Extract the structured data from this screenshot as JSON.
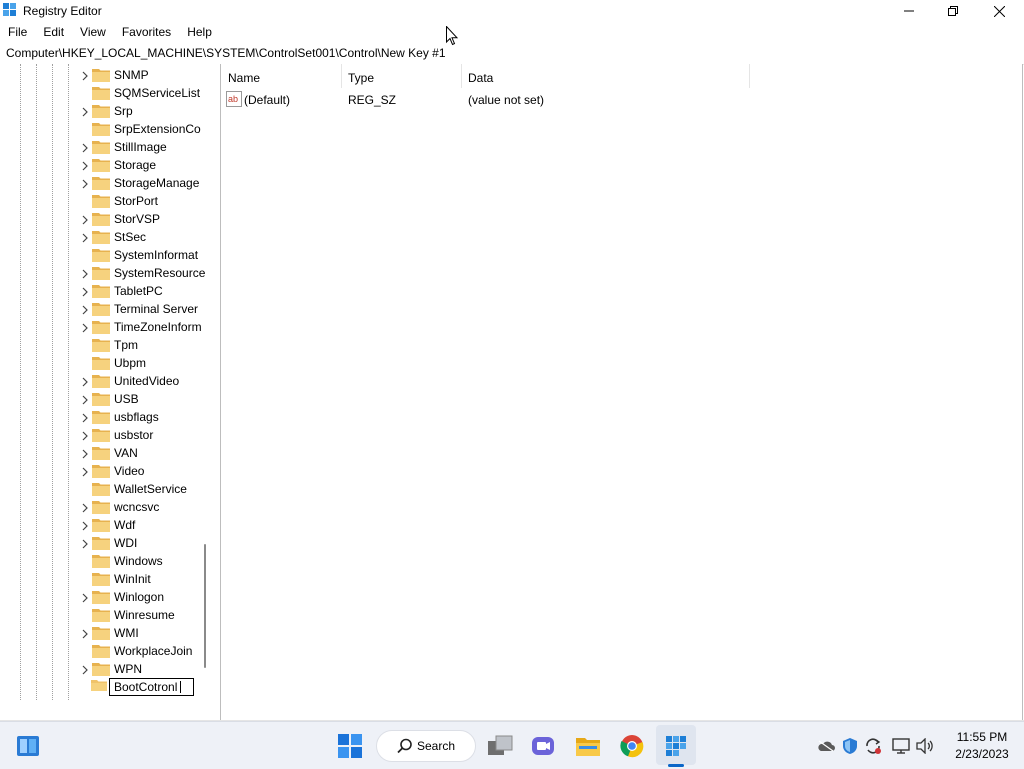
{
  "window": {
    "title": "Registry Editor",
    "icon": "registry-icon"
  },
  "menu": [
    "File",
    "Edit",
    "View",
    "Favorites",
    "Help"
  ],
  "address": {
    "path": "Computer\\HKEY_LOCAL_MACHINE\\SYSTEM\\ControlSet001\\Control\\New Key #1"
  },
  "tree": {
    "items": [
      {
        "label": "SNMP",
        "expandable": true
      },
      {
        "label": "SQMServiceList",
        "expandable": false
      },
      {
        "label": "Srp",
        "expandable": true
      },
      {
        "label": "SrpExtensionCo",
        "expandable": false
      },
      {
        "label": "StillImage",
        "expandable": true
      },
      {
        "label": "Storage",
        "expandable": true
      },
      {
        "label": "StorageManage",
        "expandable": true
      },
      {
        "label": "StorPort",
        "expandable": false
      },
      {
        "label": "StorVSP",
        "expandable": true
      },
      {
        "label": "StSec",
        "expandable": true
      },
      {
        "label": "SystemInformat",
        "expandable": false
      },
      {
        "label": "SystemResource",
        "expandable": true
      },
      {
        "label": "TabletPC",
        "expandable": true
      },
      {
        "label": "Terminal Server",
        "expandable": true
      },
      {
        "label": "TimeZoneInform",
        "expandable": true
      },
      {
        "label": "Tpm",
        "expandable": false
      },
      {
        "label": "Ubpm",
        "expandable": false
      },
      {
        "label": "UnitedVideo",
        "expandable": true
      },
      {
        "label": "USB",
        "expandable": true
      },
      {
        "label": "usbflags",
        "expandable": true
      },
      {
        "label": "usbstor",
        "expandable": true
      },
      {
        "label": "VAN",
        "expandable": true
      },
      {
        "label": "Video",
        "expandable": true
      },
      {
        "label": "WalletService",
        "expandable": false
      },
      {
        "label": "wcncsvc",
        "expandable": true
      },
      {
        "label": "Wdf",
        "expandable": true
      },
      {
        "label": "WDI",
        "expandable": true
      },
      {
        "label": "Windows",
        "expandable": false
      },
      {
        "label": "WinInit",
        "expandable": false
      },
      {
        "label": "Winlogon",
        "expandable": true
      },
      {
        "label": "Winresume",
        "expandable": false
      },
      {
        "label": "WMI",
        "expandable": true
      },
      {
        "label": "WorkplaceJoin",
        "expandable": false
      },
      {
        "label": "WPN",
        "expandable": true
      }
    ],
    "rename_value": "BootCotronl"
  },
  "values": {
    "columns": {
      "name": "Name",
      "type": "Type",
      "data": "Data"
    },
    "rows": [
      {
        "name": "(Default)",
        "type": "REG_SZ",
        "data": "(value not set)",
        "icon": "string-value-icon"
      }
    ]
  },
  "taskbar": {
    "search_label": "Search",
    "apps": [
      "start-icon",
      "search-icon",
      "task-view-icon",
      "teams-chat-icon",
      "file-explorer-icon",
      "chrome-icon",
      "registry-editor-icon"
    ],
    "tray_icons": [
      "onedrive-icon",
      "defender-icon",
      "sync-icon",
      "network-icon",
      "volume-icon"
    ],
    "time": "11:55 PM",
    "date": "2/23/2023"
  },
  "colors": {
    "folder": "#f0c36a",
    "accent": "#0a66c8"
  }
}
